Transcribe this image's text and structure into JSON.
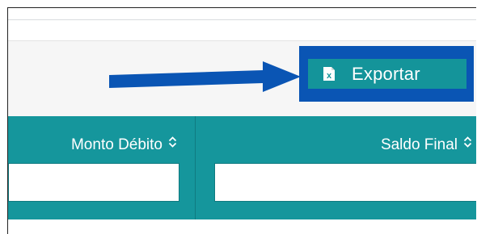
{
  "toolbar": {
    "export_label": "Exportar",
    "export_icon": "excel-icon"
  },
  "table": {
    "columns": [
      {
        "label": "Monto Débito",
        "sort_icon": "sort-icon",
        "filter_value": ""
      },
      {
        "label": "Saldo Final",
        "sort_icon": "sort-icon",
        "filter_value": ""
      }
    ]
  },
  "annotation": {
    "arrow_color": "#0a55b4",
    "highlight_color": "#0a55b4"
  },
  "colors": {
    "header_bg": "#15969c",
    "button_bg": "#14949a",
    "toolbar_bg": "#f6f6f6"
  }
}
